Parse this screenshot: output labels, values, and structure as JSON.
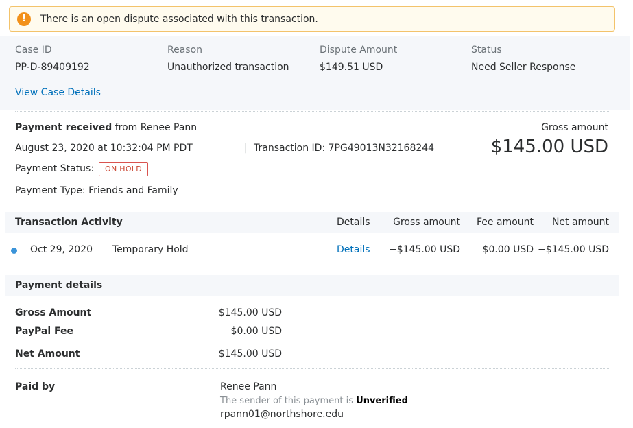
{
  "alert": {
    "icon": "exclamation-icon",
    "text": "There is an open dispute associated with this transaction."
  },
  "case": {
    "case_id_label": "Case ID",
    "case_id": "PP-D-89409192",
    "reason_label": "Reason",
    "reason": "Unauthorized transaction",
    "amount_label": "Dispute Amount",
    "amount": "$149.51 USD",
    "status_label": "Status",
    "status": "Need Seller Response",
    "view_link": "View Case Details"
  },
  "payment": {
    "received_bold": "Payment received",
    "received_rest": "from Renee Pann",
    "date": "August 23, 2020 at 10:32:04 PM PDT",
    "separator": "|",
    "transaction_id": "Transaction ID: 7PG49013N32168244",
    "status_label": "Payment Status:",
    "status_badge": "ON HOLD",
    "type": "Payment Type: Friends and Family",
    "gross_label": "Gross amount",
    "gross_value": "$145.00 USD"
  },
  "activity": {
    "title": "Transaction Activity",
    "headers": {
      "details": "Details",
      "gross": "Gross amount",
      "fee": "Fee amount",
      "net": "Net amount"
    },
    "rows": [
      {
        "date": "Oct 29, 2020",
        "description": "Temporary Hold",
        "details": "Details",
        "gross": "−$145.00 USD",
        "fee": "$0.00 USD",
        "net": "−$145.00 USD"
      }
    ]
  },
  "payment_details": {
    "title": "Payment details",
    "gross_label": "Gross Amount",
    "gross_value": "$145.00 USD",
    "fee_label": "PayPal Fee",
    "fee_value": "$0.00 USD",
    "net_label": "Net Amount",
    "net_value": "$145.00 USD",
    "paid_by_label": "Paid by",
    "payer_name": "Renee Pann",
    "sender_note": "The sender of this payment is",
    "sender_status": "Unverified",
    "payer_email": "rpann01@northshore.edu"
  }
}
